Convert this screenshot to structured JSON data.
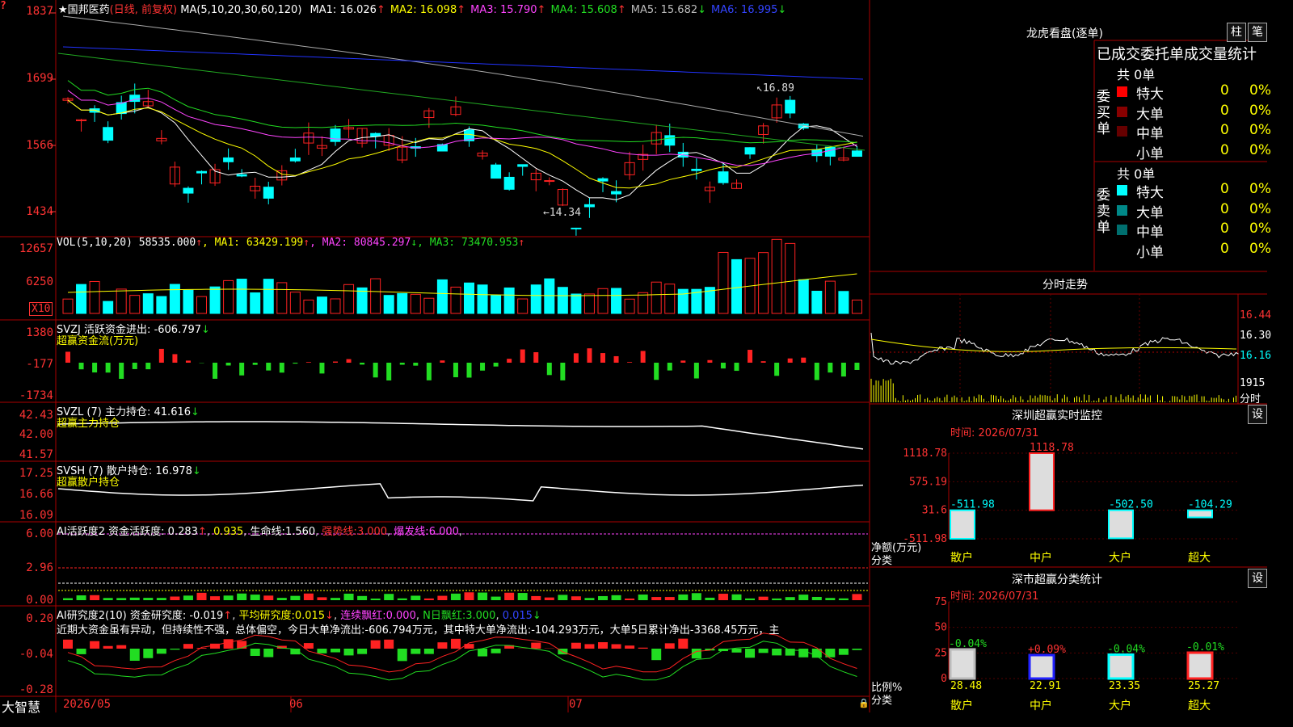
{
  "app": {
    "brand": "大智慧"
  },
  "main": {
    "title_star": "★",
    "title_name": "国邦医药",
    "title_mode": "(日线, 前复权)",
    "ma_text": "MA(5,10,20,30,60,120)",
    "ma": [
      {
        "label": "MA1:",
        "value": "16.026",
        "dir": "↑",
        "color": "#ffffff"
      },
      {
        "label": "MA2:",
        "value": "16.098",
        "dir": "↑",
        "color": "#ffff00"
      },
      {
        "label": "MA3:",
        "value": "15.790",
        "dir": "↑",
        "color": "#ff44ff"
      },
      {
        "label": "MA4:",
        "value": "15.608",
        "dir": "↑",
        "color": "#22dd22"
      },
      {
        "label": "MA5:",
        "value": "15.682",
        "dir": "↓",
        "color": "#bbbbbb"
      },
      {
        "label": "MA6:",
        "value": "16.995",
        "dir": "↓",
        "color": "#3344ff"
      }
    ],
    "y_ticks": [
      "1837",
      "1699",
      "1566",
      "1434"
    ],
    "high_label": "16.89",
    "low_label": "14.34"
  },
  "vol": {
    "title": "VOL(5,10,20)",
    "value": "58535.000",
    "dir": "↑",
    "mas": [
      {
        "label": "MA1:",
        "value": "63429.199",
        "dir": "↑",
        "color": "#ffff00"
      },
      {
        "label": "MA2:",
        "value": "80845.297",
        "dir": "↓",
        "color": "#ff44ff"
      },
      {
        "label": "MA3:",
        "value": "73470.953",
        "dir": "↑",
        "color": "#22dd22"
      }
    ],
    "y_ticks": [
      "12657",
      "6250"
    ],
    "unit": "X10"
  },
  "svzj": {
    "title": "SVZJ",
    "name": "活跃资金进出:",
    "value": "-606.797",
    "dir": "↓",
    "sub": "超赢资金流(万元)",
    "y_ticks": [
      "1380",
      "-177",
      "-1734"
    ]
  },
  "svzl": {
    "title": "SVZL (7)",
    "name": "主力持仓:",
    "value": "41.616",
    "dir": "↓",
    "sub": "超赢主力持仓",
    "y_ticks": [
      "42.43",
      "42.00",
      "41.57"
    ]
  },
  "svsh": {
    "title": "SVSH (7)",
    "name": "散户持仓:",
    "value": "16.978",
    "dir": "↓",
    "sub": "超赢散户持仓",
    "y_ticks": [
      "17.25",
      "16.66",
      "16.09"
    ]
  },
  "ai1": {
    "title": "AI活跃度2",
    "name": "资金活跃度:",
    "value": "0.283",
    "v2": "0.935",
    "life": "生命线:",
    "life_v": "1.560",
    "strong": "强势线:",
    "strong_v": "3.000",
    "burst": "爆发线:",
    "burst_v": "6.000",
    "y_ticks": [
      "6.00",
      "2.96",
      "0.00"
    ]
  },
  "ai2": {
    "title": "AI研究度2(10)",
    "name": "资金研究度:",
    "value": "-0.019",
    "avg": "平均研究度:",
    "avg_v": "0.015",
    "lianxu": "连续飘红:",
    "lianxu_v": "0.000",
    "nday": "N日飘红:",
    "nday_v": "3.000",
    "last": "0.015",
    "y_ticks": [
      "0.20",
      "-0.04",
      "-0.28"
    ],
    "comment": "近期大资金虽有异动，但持续性不强，总体偏空，今日大单净流出:-606.794万元，其中特大单净流出:-104.293万元，大单5日累计净出-3368.45万元，主"
  },
  "x_axis": [
    "2026/05",
    "06",
    "07"
  ],
  "right": {
    "dragon_title": "龙虎看盘(逐单)",
    "btn_zhu": "柱",
    "btn_bi": "笔",
    "stat_title": "已成交委托单成交量统计",
    "buy_label": "委买单",
    "sell_label": "委卖单",
    "buy_total": "共 0单",
    "sell_total": "共 0单",
    "buy_rows": [
      {
        "name": "特大",
        "count": "0",
        "pct": "0%",
        "color": "#ff0000"
      },
      {
        "name": "大单",
        "count": "0",
        "pct": "0%",
        "color": "#880000"
      },
      {
        "name": "中单",
        "count": "0",
        "pct": "0%",
        "color": "#660000"
      },
      {
        "name": "小单",
        "count": "0",
        "pct": "0%",
        "color": ""
      }
    ],
    "sell_rows": [
      {
        "name": "特大",
        "count": "0",
        "pct": "0%",
        "color": "#00ffff"
      },
      {
        "name": "大单",
        "count": "0",
        "pct": "0%",
        "color": "#008888"
      },
      {
        "name": "中单",
        "count": "0",
        "pct": "0%",
        "color": "#006f6f"
      },
      {
        "name": "小单",
        "count": "0",
        "pct": "0%",
        "color": ""
      }
    ],
    "intraday_title": "分时走势",
    "intraday_ticks": [
      "16.44",
      "16.30",
      "16.16",
      "1915",
      "分时"
    ],
    "monitor_title": "深圳超赢实时监控",
    "monitor_btn": "设",
    "monitor_time": "时间: 2026/07/31",
    "monitor_y": [
      "1118.78",
      "575.19",
      "31.6",
      "-511.98"
    ],
    "monitor_ylabel": "净额(万元)",
    "monitor_xlabel": "分类",
    "classify_title": "深市超赢分类统计",
    "classify_btn": "设",
    "classify_time": "时间: 2026/07/31",
    "classify_y": [
      "75",
      "50",
      "25",
      "0"
    ],
    "classify_ylabel": "比例%",
    "classify_xlabel": "分类"
  },
  "chart_data": [
    {
      "type": "bar",
      "title": "深圳超赢实时监控",
      "categories": [
        "散户",
        "中户",
        "大户",
        "超大"
      ],
      "values": [
        -511.98,
        1118.78,
        -502.5,
        -104.29
      ],
      "ylabel": "净额(万元)",
      "xlabel": "分类",
      "ylim": [
        -511.98,
        1118.78
      ]
    },
    {
      "type": "bar",
      "title": "深市超赢分类统计",
      "categories": [
        "散户",
        "中户",
        "大户",
        "超大"
      ],
      "values": [
        28.48,
        22.91,
        23.35,
        25.27
      ],
      "changes": [
        "-0.04%",
        "+0.09%",
        "-0.04%",
        "-0.01%"
      ],
      "ylabel": "比例%",
      "xlabel": "分类",
      "ylim": [
        0,
        75
      ]
    }
  ]
}
